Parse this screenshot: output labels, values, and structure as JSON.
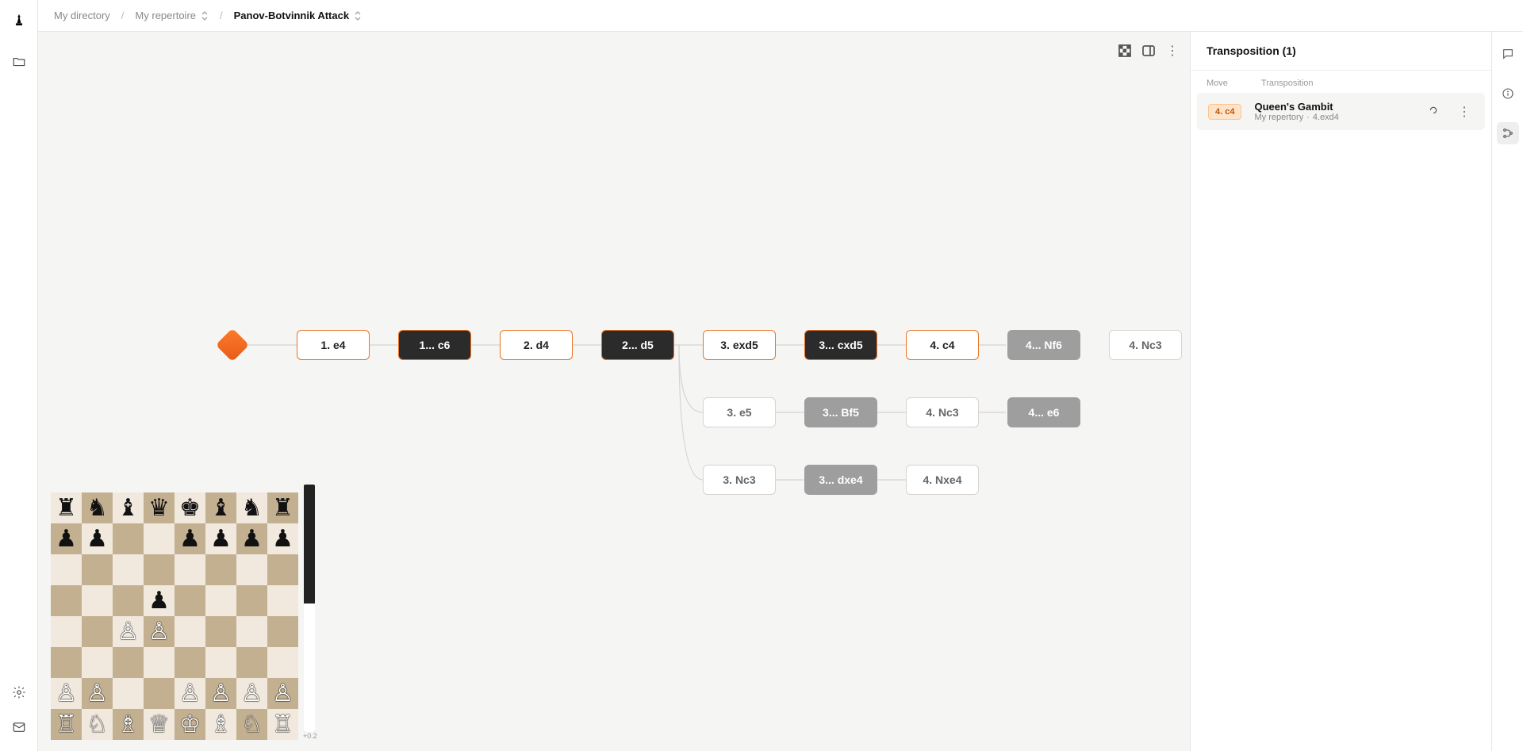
{
  "breadcrumb": {
    "root": "My directory",
    "folder": "My repertoire",
    "page": "Panov-Botvinnik Attack"
  },
  "tree": {
    "rows": [
      [
        {
          "label": "1. e4",
          "style": "white-main"
        },
        {
          "label": "1... c6",
          "style": "black-main"
        },
        {
          "label": "2. d4",
          "style": "white-main"
        },
        {
          "label": "2... d5",
          "style": "black-main"
        },
        {
          "label": "3. exd5",
          "style": "white-main"
        },
        {
          "label": "3... cxd5",
          "style": "black-main"
        },
        {
          "label": "4. c4",
          "style": "white-main"
        },
        {
          "label": "4... Nf6",
          "style": "black-sub"
        },
        {
          "label": "4. Nc3",
          "style": "white-sub"
        }
      ],
      [
        null,
        null,
        null,
        null,
        {
          "label": "3. e5",
          "style": "white-sub"
        },
        {
          "label": "3... Bf5",
          "style": "black-sub"
        },
        {
          "label": "4. Nc3",
          "style": "white-sub"
        },
        {
          "label": "4... e6",
          "style": "black-sub"
        }
      ],
      [
        null,
        null,
        null,
        null,
        {
          "label": "3. Nc3",
          "style": "white-sub"
        },
        {
          "label": "3... dxe4",
          "style": "black-sub"
        },
        {
          "label": "4. Nxe4",
          "style": "white-sub"
        }
      ]
    ]
  },
  "eval": {
    "value_text": "+0.2",
    "white_percent": 52
  },
  "board_fen_rows": [
    "rnbqkbnr",
    "pp..pppp",
    "........",
    "...p....",
    "..PP....",
    "........",
    "PP..PPPP",
    "RNBQKBNR"
  ],
  "right_panel": {
    "title": "Transposition (1)",
    "col_move": "Move",
    "col_trans": "Transposition",
    "items": [
      {
        "move": "4. c4",
        "name": "Queen's Gambit",
        "source": "My repertory",
        "path": "4.exd4"
      }
    ]
  }
}
